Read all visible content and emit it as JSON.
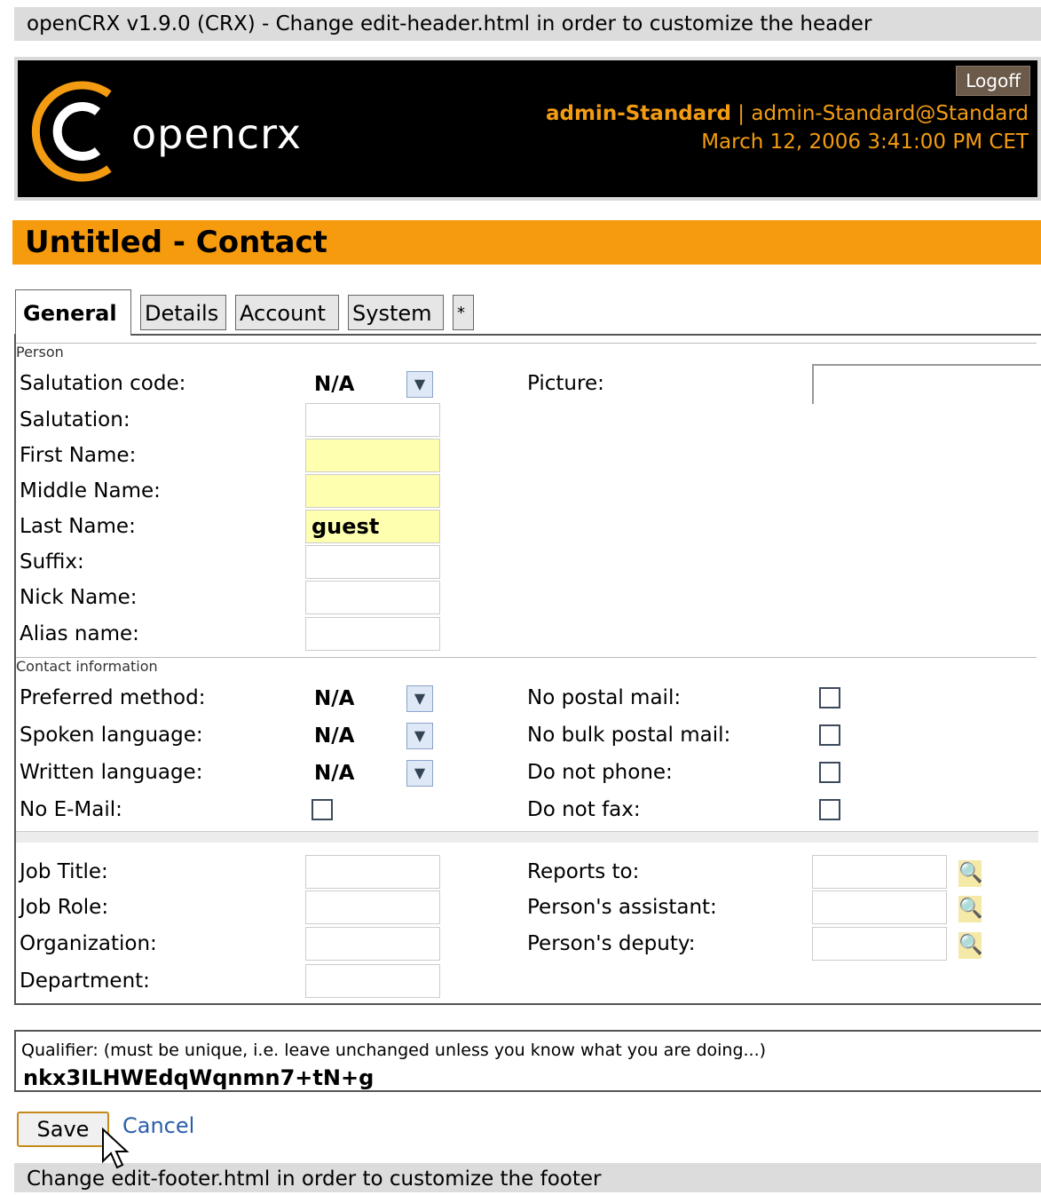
{
  "topbar": {
    "text": "openCRX v1.9.0 (CRX) - Change edit-header.html in order to customize the header"
  },
  "header": {
    "brand": "opencrx",
    "logoff": "Logoff",
    "user": "admin-Standard",
    "separator": " | ",
    "principal": "admin-Standard@Standard",
    "datetime": "March 12, 2006 3:41:00 PM CET",
    "accent_color": "#f39c12"
  },
  "title": "Untitled - Contact",
  "tabs": [
    {
      "label": "General"
    },
    {
      "label": "Details"
    },
    {
      "label": "Account"
    },
    {
      "label": "System"
    },
    {
      "label": "*"
    }
  ],
  "sections": {
    "person": "Person",
    "contact": "Contact information"
  },
  "person": {
    "salutation_code_label": "Salutation code:",
    "salutation_code_value": "N/A",
    "picture_label": "Picture:",
    "salutation_label": "Salutation:",
    "first_name_label": "First Name:",
    "middle_name_label": "Middle Name:",
    "last_name_label": "Last Name:",
    "last_name_value": "guest",
    "suffix_label": "Suffix:",
    "nick_name_label": "Nick Name:",
    "alias_name_label": "Alias name:"
  },
  "contact": {
    "preferred_method_label": "Preferred method:",
    "preferred_method_value": "N/A",
    "spoken_language_label": "Spoken language:",
    "spoken_language_value": "N/A",
    "written_language_label": "Written language:",
    "written_language_value": "N/A",
    "no_email_label": "No E-Mail:",
    "no_postal_mail_label": "No postal mail:",
    "no_bulk_postal_mail_label": "No bulk postal mail:",
    "do_not_phone_label": "Do not phone:",
    "do_not_fax_label": "Do not fax:"
  },
  "job": {
    "job_title_label": "Job Title:",
    "job_role_label": "Job Role:",
    "organization_label": "Organization:",
    "department_label": "Department:",
    "reports_to_label": "Reports to:",
    "assistant_label": "Person's assistant:",
    "deputy_label": "Person's deputy:"
  },
  "qualifier": {
    "text": "Qualifier: (must be unique, i.e. leave unchanged unless you know what you are doing...)",
    "value": "nkx3ILHWEdqWqnmn7+tN+g"
  },
  "actions": {
    "save": "Save",
    "cancel": "Cancel"
  },
  "footer": {
    "text": "Change edit-footer.html in order to customize the footer"
  }
}
